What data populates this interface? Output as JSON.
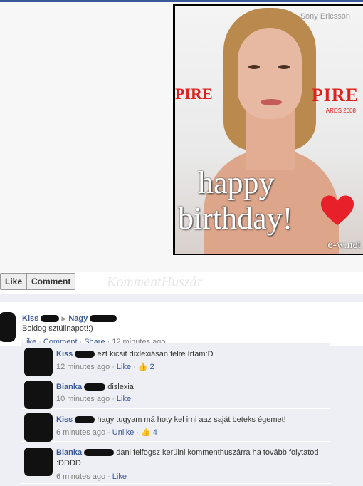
{
  "photo": {
    "sponsor": "Sony Ericsson",
    "logo_left": "PIRE",
    "logo_right": "PIRE",
    "awards": "ARDS 2008",
    "happy": "happy",
    "birthday": "birthday!",
    "credit": "e-w.net"
  },
  "actions": {
    "like": "Like",
    "comment": "Comment"
  },
  "watermark": "KommentHuszár",
  "post": {
    "author_first": "Kiss",
    "arrow": "▶",
    "target_first": "Nagy",
    "text": "Boldog sztülinapot!:)",
    "like": "Like",
    "comment": "Comment",
    "share": "Share",
    "time": "12 minutes ago"
  },
  "replies": [
    {
      "name": "Kiss",
      "text": "ezt kicsit dixlexiásan félre írtam:D",
      "time": "12 minutes ago",
      "action": "Like",
      "likes": "2"
    },
    {
      "name": "Bianka",
      "text": "dislexia",
      "time": "10 minutes ago",
      "action": "Like",
      "likes": ""
    },
    {
      "name": "Kiss",
      "text": "hagy tugyam má hoty kel irni aaz saját beteks égemet!",
      "time": "6 minutes ago",
      "action": "Unlike",
      "likes": "4"
    },
    {
      "name": "Bianka",
      "text": "dani felfogsz kerülni kommenthuszárra ha tovább folytatod :DDDD",
      "time": "6 minutes ago",
      "action": "Like",
      "likes": ""
    }
  ],
  "colors": {
    "link": "#3b5998",
    "meta": "#808080",
    "background": "#edeff4"
  }
}
